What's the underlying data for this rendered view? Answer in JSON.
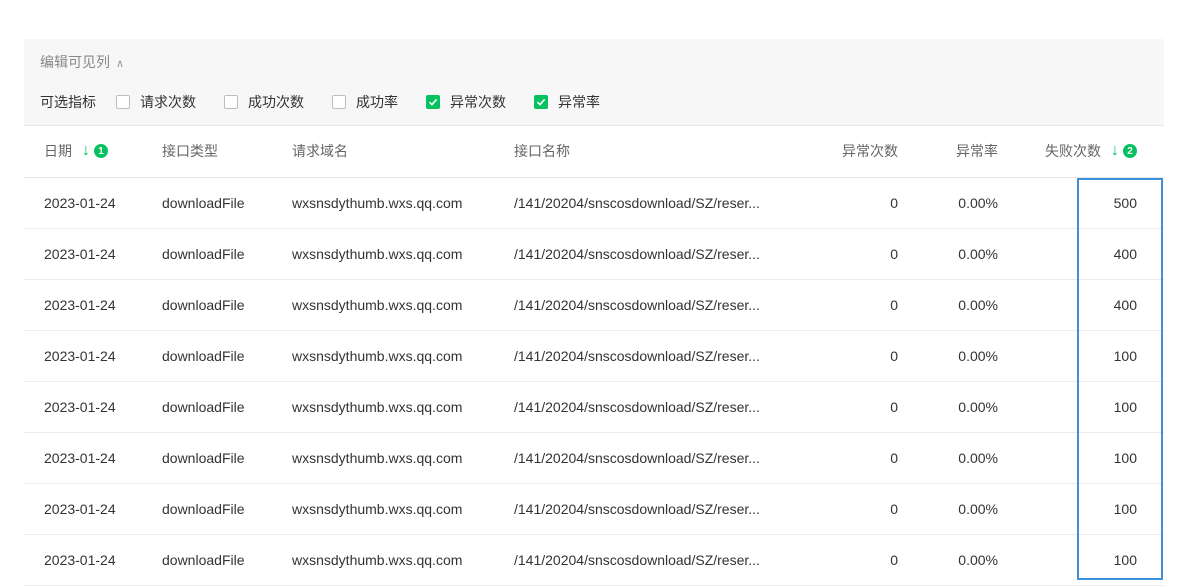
{
  "panel": {
    "edit_columns": "编辑可见列",
    "options_title": "可选指标",
    "options": [
      {
        "label": "请求次数",
        "checked": false
      },
      {
        "label": "成功次数",
        "checked": false
      },
      {
        "label": "成功率",
        "checked": false
      },
      {
        "label": "异常次数",
        "checked": true
      },
      {
        "label": "异常率",
        "checked": true
      }
    ]
  },
  "table": {
    "headers": {
      "date": "日期",
      "type": "接口类型",
      "domain": "请求域名",
      "name": "接口名称",
      "exceptions": "异常次数",
      "exception_rate": "异常率",
      "failures": "失败次数"
    },
    "sort_badges": [
      "1",
      "2"
    ],
    "rows": [
      {
        "date": "2023-01-24",
        "type": "downloadFile",
        "domain": "wxsnsdythumb.wxs.qq.com",
        "name": "/141/20204/snscosdownload/SZ/reser...",
        "exceptions": "0",
        "exception_rate": "0.00%",
        "failures": "500"
      },
      {
        "date": "2023-01-24",
        "type": "downloadFile",
        "domain": "wxsnsdythumb.wxs.qq.com",
        "name": "/141/20204/snscosdownload/SZ/reser...",
        "exceptions": "0",
        "exception_rate": "0.00%",
        "failures": "400"
      },
      {
        "date": "2023-01-24",
        "type": "downloadFile",
        "domain": "wxsnsdythumb.wxs.qq.com",
        "name": "/141/20204/snscosdownload/SZ/reser...",
        "exceptions": "0",
        "exception_rate": "0.00%",
        "failures": "400"
      },
      {
        "date": "2023-01-24",
        "type": "downloadFile",
        "domain": "wxsnsdythumb.wxs.qq.com",
        "name": "/141/20204/snscosdownload/SZ/reser...",
        "exceptions": "0",
        "exception_rate": "0.00%",
        "failures": "100"
      },
      {
        "date": "2023-01-24",
        "type": "downloadFile",
        "domain": "wxsnsdythumb.wxs.qq.com",
        "name": "/141/20204/snscosdownload/SZ/reser...",
        "exceptions": "0",
        "exception_rate": "0.00%",
        "failures": "100"
      },
      {
        "date": "2023-01-24",
        "type": "downloadFile",
        "domain": "wxsnsdythumb.wxs.qq.com",
        "name": "/141/20204/snscosdownload/SZ/reser...",
        "exceptions": "0",
        "exception_rate": "0.00%",
        "failures": "100"
      },
      {
        "date": "2023-01-24",
        "type": "downloadFile",
        "domain": "wxsnsdythumb.wxs.qq.com",
        "name": "/141/20204/snscosdownload/SZ/reser...",
        "exceptions": "0",
        "exception_rate": "0.00%",
        "failures": "100"
      },
      {
        "date": "2023-01-24",
        "type": "downloadFile",
        "domain": "wxsnsdythumb.wxs.qq.com",
        "name": "/141/20204/snscosdownload/SZ/reser...",
        "exceptions": "0",
        "exception_rate": "0.00%",
        "failures": "100"
      }
    ]
  },
  "colors": {
    "accent": "#07c160",
    "highlight": "#3d8fdc"
  },
  "icons": {
    "sort": "arrow-down-icon",
    "collapse": "chevron-up-icon",
    "check": "check-icon"
  }
}
